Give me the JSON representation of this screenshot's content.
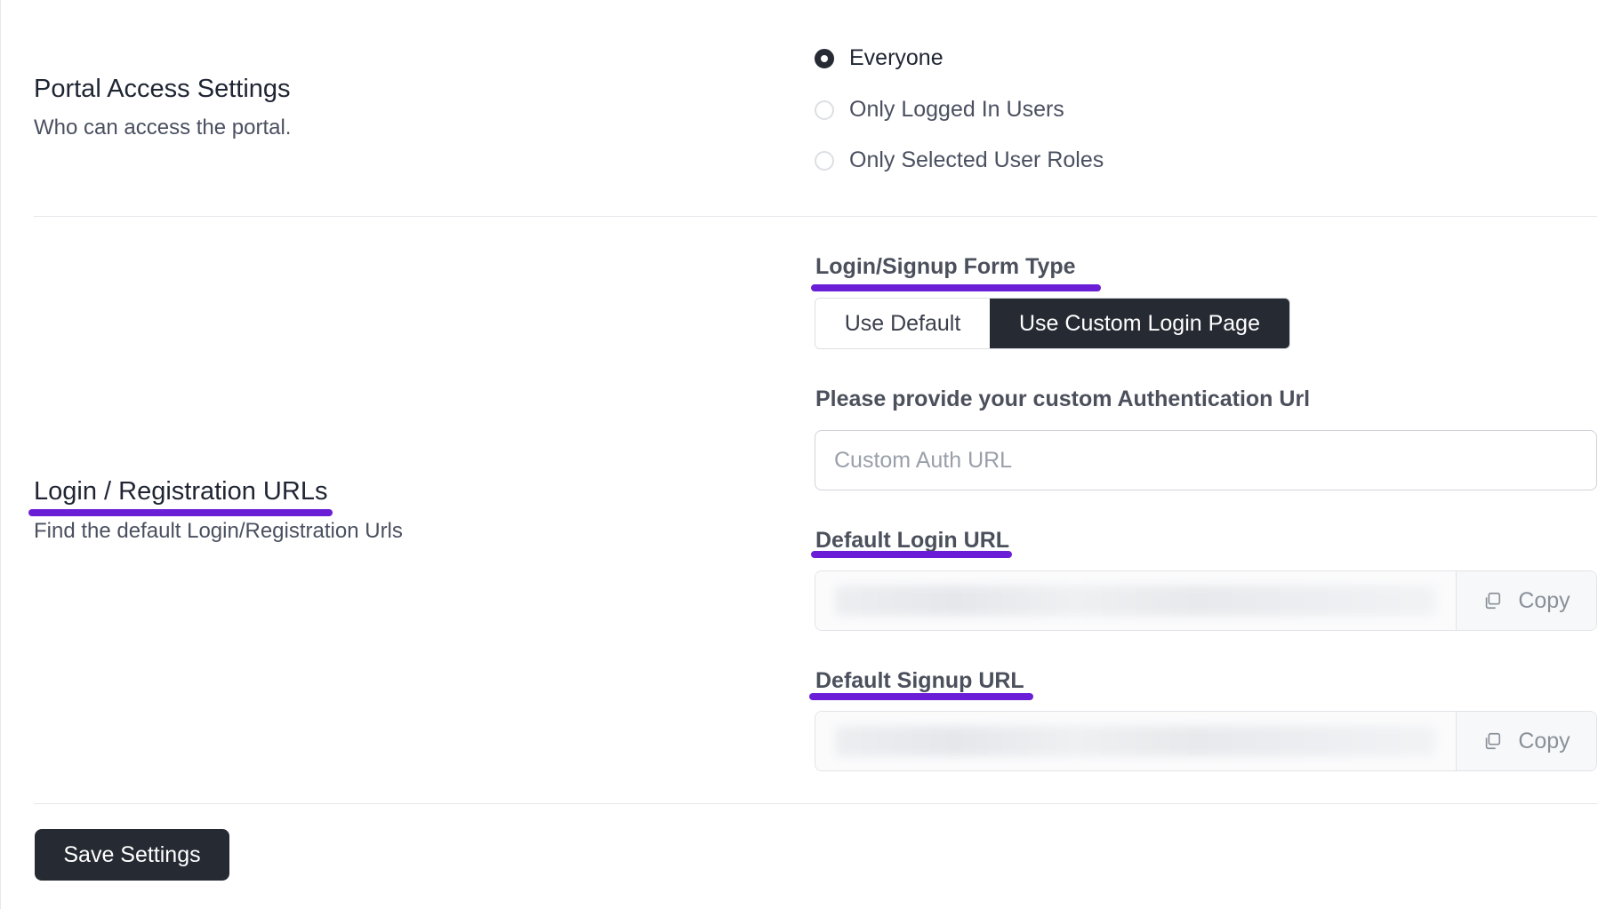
{
  "portal_access": {
    "title": "Portal Access Settings",
    "description": "Who can access the portal.",
    "options": [
      {
        "label": "Everyone",
        "checked": true
      },
      {
        "label": "Only Logged In Users",
        "checked": false
      },
      {
        "label": "Only Selected User Roles",
        "checked": false
      }
    ]
  },
  "login_urls": {
    "title": "Login / Registration URLs",
    "description": "Find the default Login/Registration Urls",
    "form_type_label": "Login/Signup Form Type",
    "form_type_options": {
      "default": "Use Default",
      "custom": "Use Custom Login Page"
    },
    "form_type_selected": "custom",
    "custom_url_label": "Please provide your custom Authentication Url",
    "custom_url_placeholder": "Custom Auth URL",
    "custom_url_value": "",
    "default_login_label": "Default Login URL",
    "default_signup_label": "Default Signup URL",
    "copy_label": "Copy"
  },
  "save_button_label": "Save Settings",
  "colors": {
    "accent_dark": "#262a33",
    "annotation_underline": "#6a1fd6"
  }
}
